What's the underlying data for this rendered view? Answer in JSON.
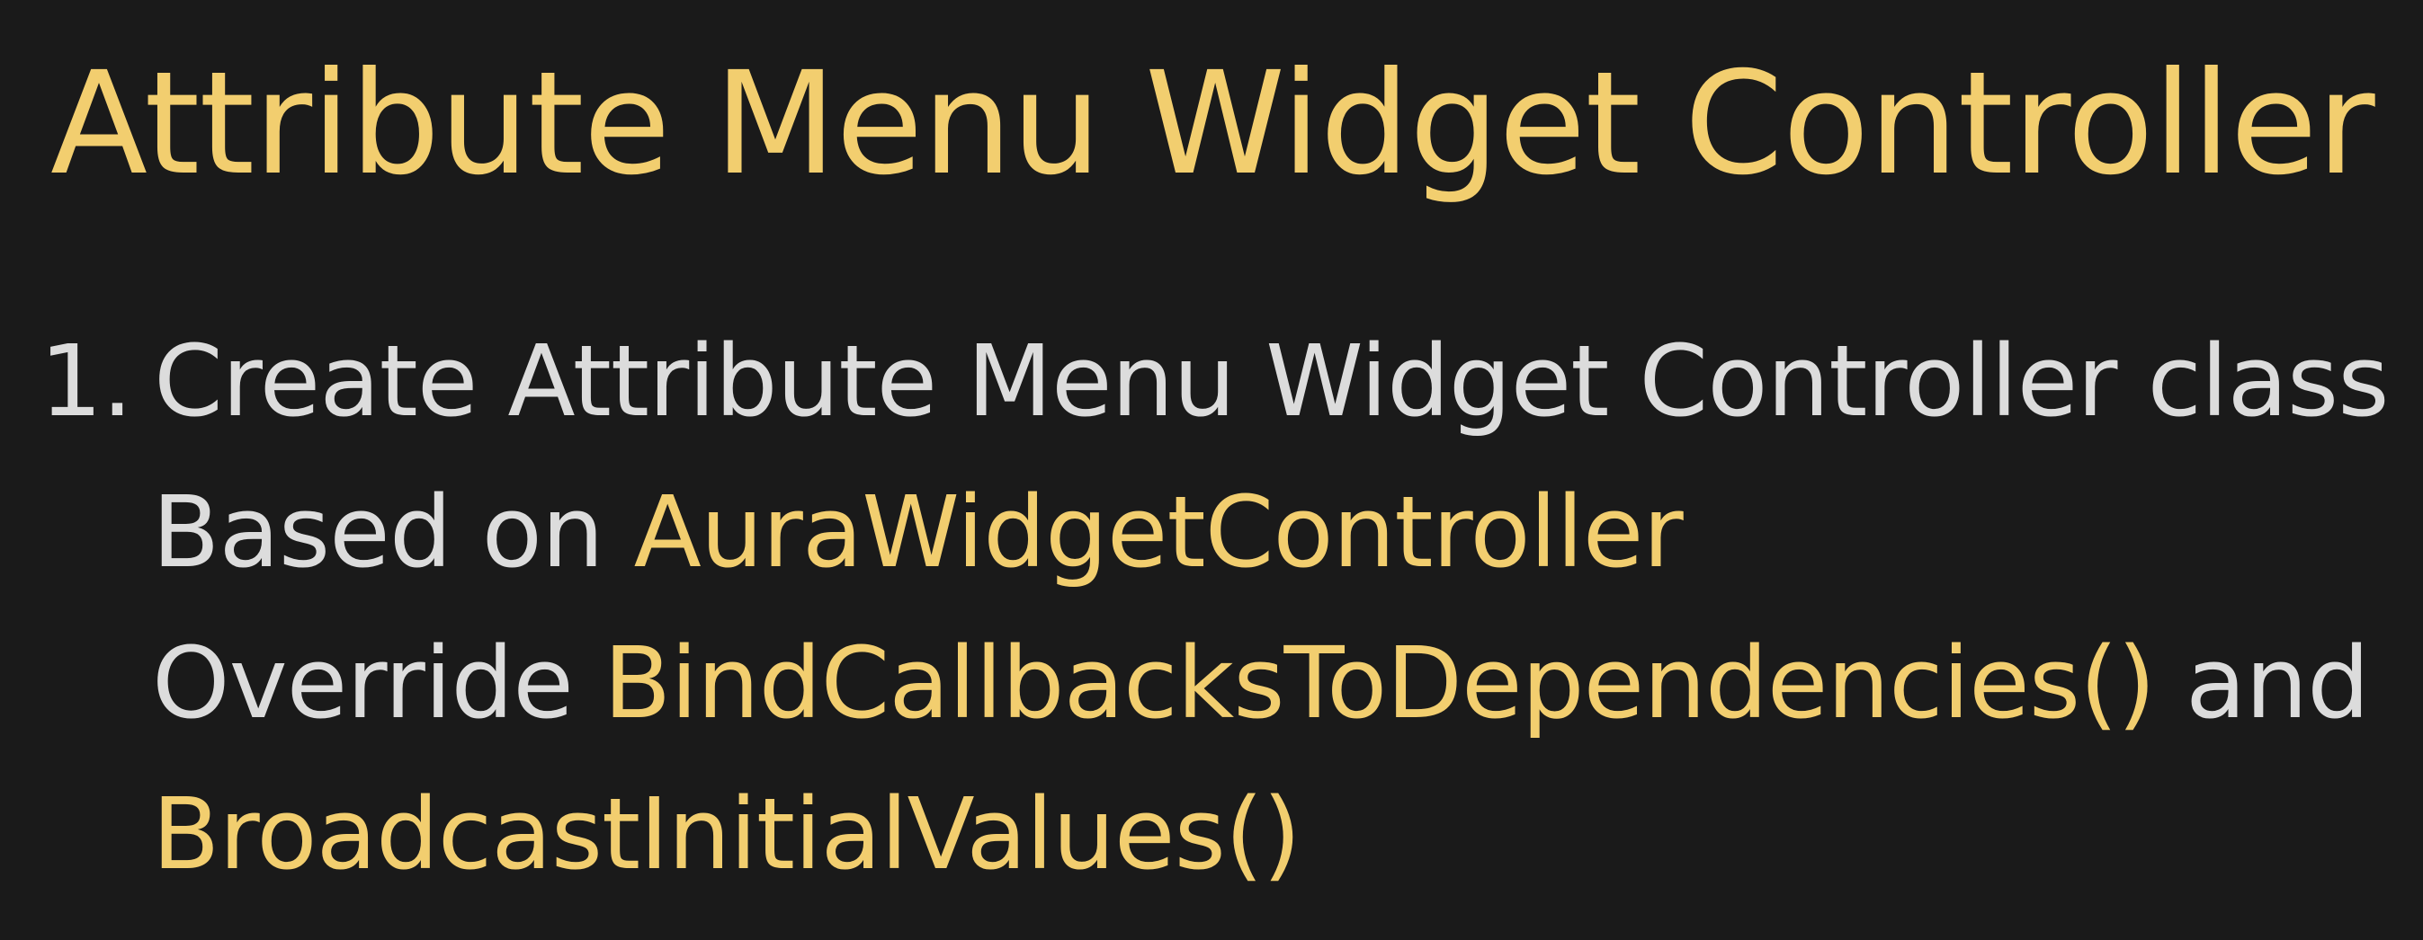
{
  "title": "Attribute Menu Widget Controller",
  "steps": [
    {
      "number": "1.",
      "text": "Create Attribute Menu Widget Controller class"
    }
  ],
  "details": {
    "based_on_label": "Based on",
    "based_on_class": "AuraWidgetController",
    "override_label": "Override",
    "override_fn1": "BindCallbacksToDependencies()",
    "and_word": "and",
    "override_fn2": "BroadcastInitialValues()"
  },
  "colors": {
    "background": "#1a1a1a",
    "highlight": "#F2CE6F",
    "text": "#DCDCDC"
  }
}
